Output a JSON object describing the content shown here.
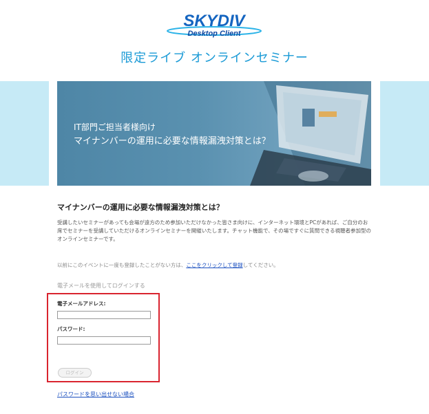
{
  "header": {
    "logo_main": "SKYDIV",
    "logo_sub": "Desktop Client",
    "title": "限定ライブ オンラインセミナー"
  },
  "hero": {
    "subtitle": "IT部門ご担当者様向け",
    "title": "マイナンバーの運用に必要な情報漏洩対策とは？"
  },
  "content": {
    "heading": "マイナンバーの運用に必要な情報漏洩対策とは？",
    "description": "受講したいセミナーがあっても会場が遠方のため参加いただけなかった皆さま向けに、インターネット環境とPCがあれば、ご自分のお席でセミナーを受講していただけるオンラインセミナーを開催いたします。チャット機能で、その場ですぐに質問できる視聴者参加型のオンラインセミナーです。",
    "register_prefix": "以前にこのイベントに一度も登録したことがない方は、",
    "register_link": "ここをクリックして登録",
    "register_suffix": "してください。"
  },
  "login": {
    "caption": "電子メールを使用してログインする",
    "email_label": "電子メールアドレス:",
    "email_value": "",
    "password_label": "パスワード:",
    "password_value": "",
    "button_label": "ログイン",
    "forgot_link": "パスワードを思い出せない場合"
  },
  "colors": {
    "accent": "#1a9ad6",
    "band": "#c6eaf6",
    "highlight_border": "#d9232e",
    "link": "#1a4fbf"
  }
}
